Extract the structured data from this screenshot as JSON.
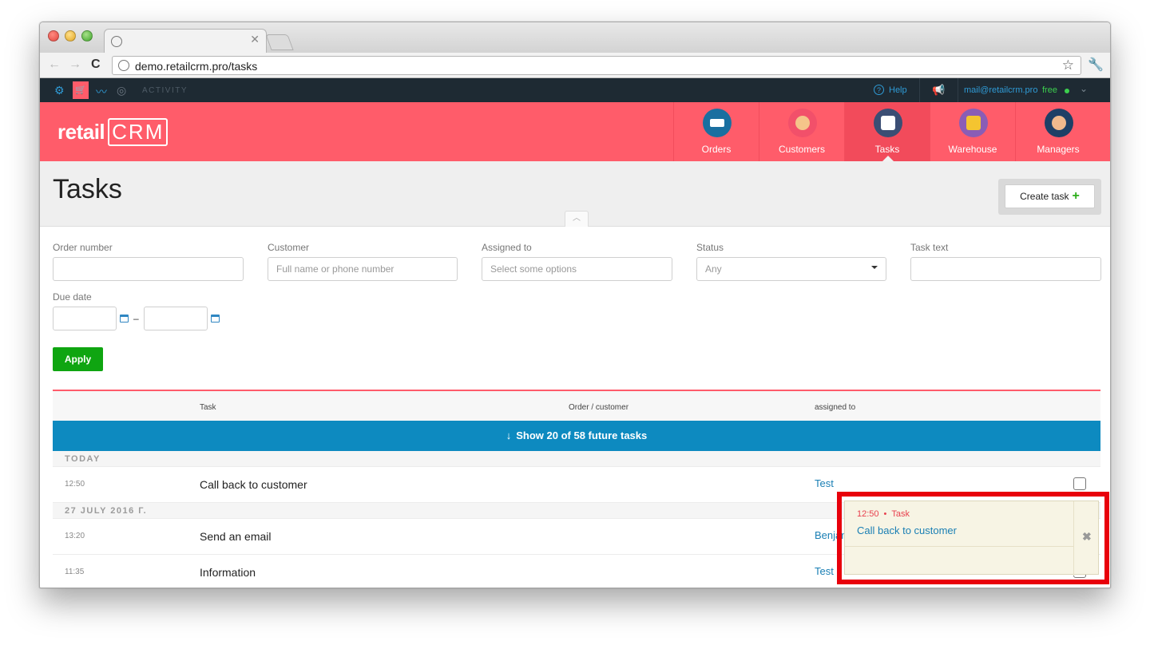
{
  "browser": {
    "url": "demo.retailcrm.pro/tasks"
  },
  "appbar": {
    "activity_label": "ACTIVITY",
    "help_label": "Help",
    "user_email": "mail@retailcrm.pro",
    "plan": "free",
    "accent_color": "#2f9bd6"
  },
  "header": {
    "logo": "retail",
    "logo_crm": "CRM",
    "brand_color": "#ff5c6a",
    "nav": [
      {
        "label": "Orders",
        "icon": "orders-cart-icon",
        "active": false
      },
      {
        "label": "Customers",
        "icon": "customer-avatar-icon",
        "active": false
      },
      {
        "label": "Tasks",
        "icon": "tasks-list-icon",
        "active": true
      },
      {
        "label": "Warehouse",
        "icon": "warehouse-box-icon",
        "active": false
      },
      {
        "label": "Managers",
        "icon": "manager-avatar-icon",
        "active": false
      }
    ]
  },
  "page": {
    "title": "Tasks",
    "create_button": "Create task"
  },
  "filters": {
    "order_number": {
      "label": "Order number",
      "value": ""
    },
    "customer": {
      "label": "Customer",
      "placeholder": "Full name or phone number"
    },
    "assigned_to": {
      "label": "Assigned to",
      "placeholder": "Select some options"
    },
    "status": {
      "label": "Status",
      "value": "Any"
    },
    "task_text": {
      "label": "Task text",
      "value": ""
    },
    "due_date": {
      "label": "Due date",
      "dash": "–"
    },
    "apply_label": "Apply"
  },
  "table": {
    "columns": [
      "Task",
      "Order / customer",
      "assigned to"
    ],
    "show_future": "Show 20 of 58 future tasks",
    "groups": [
      {
        "title": "TODAY",
        "rows": [
          {
            "time": "12:50",
            "task": "Call back to customer",
            "assignee": "Test"
          }
        ]
      },
      {
        "title": "27 JULY 2016 Г.",
        "rows": [
          {
            "time": "13:20",
            "task": "Send an email",
            "assignee": "Benjamin Hall"
          },
          {
            "time": "11:35",
            "task": "Information",
            "assignee": "Test"
          }
        ]
      }
    ]
  },
  "notification": {
    "time": "12:50",
    "type": "Task",
    "message": "Call back to customer",
    "highlight_color": "#e8000b"
  }
}
